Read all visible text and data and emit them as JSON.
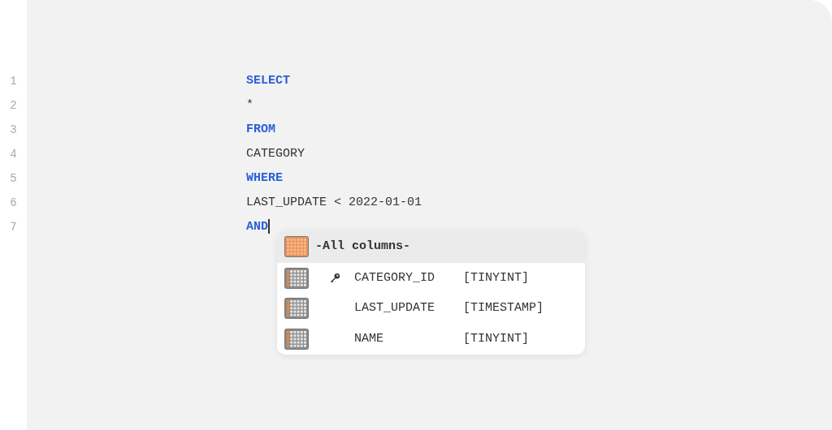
{
  "editor": {
    "lines": [
      {
        "number": "1",
        "text": "SELECT",
        "kind": "keyword",
        "cursor": false
      },
      {
        "number": "2",
        "text": "*",
        "kind": "plain",
        "cursor": false
      },
      {
        "number": "3",
        "text": "FROM",
        "kind": "keyword",
        "cursor": false
      },
      {
        "number": "4",
        "text": "CATEGORY",
        "kind": "plain",
        "cursor": false
      },
      {
        "number": "5",
        "text": "WHERE",
        "kind": "keyword",
        "cursor": false
      },
      {
        "number": "6",
        "text": "LAST_UPDATE < 2022-01-01",
        "kind": "plain",
        "cursor": false
      },
      {
        "number": "7",
        "text": "AND",
        "kind": "keyword",
        "cursor": true
      }
    ]
  },
  "autocomplete": {
    "items": [
      {
        "kind": "all",
        "label": "-All columns-",
        "selected": true
      },
      {
        "kind": "column",
        "label": "CATEGORY_ID",
        "type": "[TINYINT]",
        "key": true,
        "selected": false
      },
      {
        "kind": "column",
        "label": "LAST_UPDATE",
        "type": "[TIMESTAMP]",
        "key": false,
        "selected": false
      },
      {
        "kind": "column",
        "label": "NAME",
        "type": "[TINYINT]",
        "key": false,
        "selected": false
      }
    ]
  }
}
